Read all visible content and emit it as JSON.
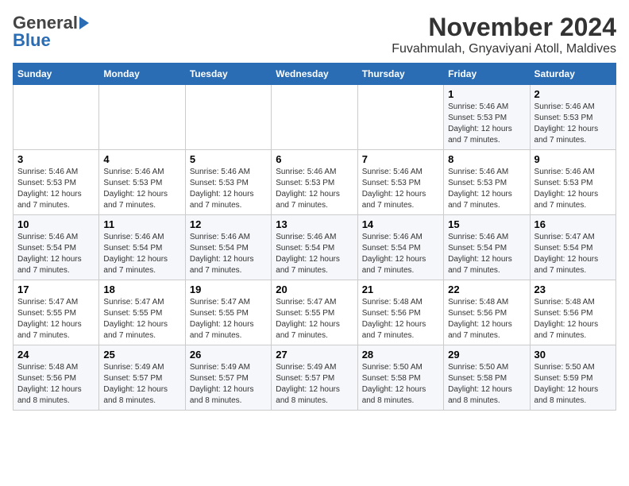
{
  "logo": {
    "general": "General",
    "blue": "Blue"
  },
  "title": "November 2024",
  "subtitle": "Fuvahmulah, Gnyaviyani Atoll, Maldives",
  "days_of_week": [
    "Sunday",
    "Monday",
    "Tuesday",
    "Wednesday",
    "Thursday",
    "Friday",
    "Saturday"
  ],
  "weeks": [
    [
      {
        "day": "",
        "info": ""
      },
      {
        "day": "",
        "info": ""
      },
      {
        "day": "",
        "info": ""
      },
      {
        "day": "",
        "info": ""
      },
      {
        "day": "",
        "info": ""
      },
      {
        "day": "1",
        "info": "Sunrise: 5:46 AM\nSunset: 5:53 PM\nDaylight: 12 hours and 7 minutes."
      },
      {
        "day": "2",
        "info": "Sunrise: 5:46 AM\nSunset: 5:53 PM\nDaylight: 12 hours and 7 minutes."
      }
    ],
    [
      {
        "day": "3",
        "info": "Sunrise: 5:46 AM\nSunset: 5:53 PM\nDaylight: 12 hours and 7 minutes."
      },
      {
        "day": "4",
        "info": "Sunrise: 5:46 AM\nSunset: 5:53 PM\nDaylight: 12 hours and 7 minutes."
      },
      {
        "day": "5",
        "info": "Sunrise: 5:46 AM\nSunset: 5:53 PM\nDaylight: 12 hours and 7 minutes."
      },
      {
        "day": "6",
        "info": "Sunrise: 5:46 AM\nSunset: 5:53 PM\nDaylight: 12 hours and 7 minutes."
      },
      {
        "day": "7",
        "info": "Sunrise: 5:46 AM\nSunset: 5:53 PM\nDaylight: 12 hours and 7 minutes."
      },
      {
        "day": "8",
        "info": "Sunrise: 5:46 AM\nSunset: 5:53 PM\nDaylight: 12 hours and 7 minutes."
      },
      {
        "day": "9",
        "info": "Sunrise: 5:46 AM\nSunset: 5:53 PM\nDaylight: 12 hours and 7 minutes."
      }
    ],
    [
      {
        "day": "10",
        "info": "Sunrise: 5:46 AM\nSunset: 5:54 PM\nDaylight: 12 hours and 7 minutes."
      },
      {
        "day": "11",
        "info": "Sunrise: 5:46 AM\nSunset: 5:54 PM\nDaylight: 12 hours and 7 minutes."
      },
      {
        "day": "12",
        "info": "Sunrise: 5:46 AM\nSunset: 5:54 PM\nDaylight: 12 hours and 7 minutes."
      },
      {
        "day": "13",
        "info": "Sunrise: 5:46 AM\nSunset: 5:54 PM\nDaylight: 12 hours and 7 minutes."
      },
      {
        "day": "14",
        "info": "Sunrise: 5:46 AM\nSunset: 5:54 PM\nDaylight: 12 hours and 7 minutes."
      },
      {
        "day": "15",
        "info": "Sunrise: 5:46 AM\nSunset: 5:54 PM\nDaylight: 12 hours and 7 minutes."
      },
      {
        "day": "16",
        "info": "Sunrise: 5:47 AM\nSunset: 5:54 PM\nDaylight: 12 hours and 7 minutes."
      }
    ],
    [
      {
        "day": "17",
        "info": "Sunrise: 5:47 AM\nSunset: 5:55 PM\nDaylight: 12 hours and 7 minutes."
      },
      {
        "day": "18",
        "info": "Sunrise: 5:47 AM\nSunset: 5:55 PM\nDaylight: 12 hours and 7 minutes."
      },
      {
        "day": "19",
        "info": "Sunrise: 5:47 AM\nSunset: 5:55 PM\nDaylight: 12 hours and 7 minutes."
      },
      {
        "day": "20",
        "info": "Sunrise: 5:47 AM\nSunset: 5:55 PM\nDaylight: 12 hours and 7 minutes."
      },
      {
        "day": "21",
        "info": "Sunrise: 5:48 AM\nSunset: 5:56 PM\nDaylight: 12 hours and 7 minutes."
      },
      {
        "day": "22",
        "info": "Sunrise: 5:48 AM\nSunset: 5:56 PM\nDaylight: 12 hours and 7 minutes."
      },
      {
        "day": "23",
        "info": "Sunrise: 5:48 AM\nSunset: 5:56 PM\nDaylight: 12 hours and 7 minutes."
      }
    ],
    [
      {
        "day": "24",
        "info": "Sunrise: 5:48 AM\nSunset: 5:56 PM\nDaylight: 12 hours and 8 minutes."
      },
      {
        "day": "25",
        "info": "Sunrise: 5:49 AM\nSunset: 5:57 PM\nDaylight: 12 hours and 8 minutes."
      },
      {
        "day": "26",
        "info": "Sunrise: 5:49 AM\nSunset: 5:57 PM\nDaylight: 12 hours and 8 minutes."
      },
      {
        "day": "27",
        "info": "Sunrise: 5:49 AM\nSunset: 5:57 PM\nDaylight: 12 hours and 8 minutes."
      },
      {
        "day": "28",
        "info": "Sunrise: 5:50 AM\nSunset: 5:58 PM\nDaylight: 12 hours and 8 minutes."
      },
      {
        "day": "29",
        "info": "Sunrise: 5:50 AM\nSunset: 5:58 PM\nDaylight: 12 hours and 8 minutes."
      },
      {
        "day": "30",
        "info": "Sunrise: 5:50 AM\nSunset: 5:59 PM\nDaylight: 12 hours and 8 minutes."
      }
    ]
  ]
}
